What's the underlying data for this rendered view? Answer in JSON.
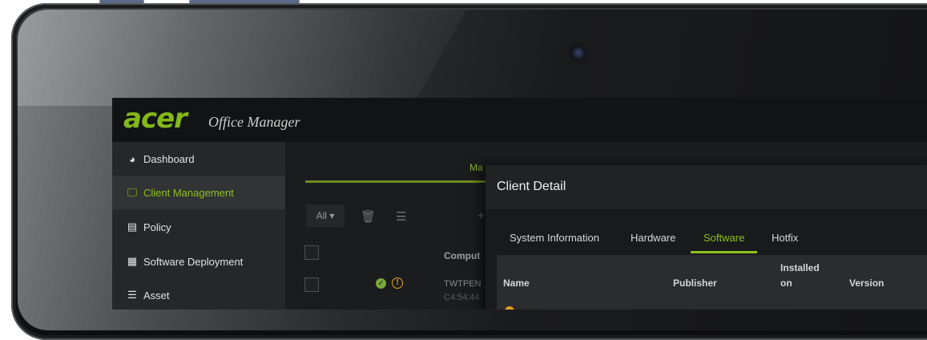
{
  "app": {
    "brand": "acer",
    "product": "Office Manager"
  },
  "sidebar": {
    "items": [
      {
        "label": "Dashboard",
        "icon": "pie-chart-icon",
        "glyph": "◕"
      },
      {
        "label": "Client Management",
        "icon": "monitor-icon",
        "glyph": "🖵"
      },
      {
        "label": "Policy",
        "icon": "policy-document-icon",
        "glyph": "▤"
      },
      {
        "label": "Software Deployment",
        "icon": "grid-icon",
        "glyph": "▦"
      },
      {
        "label": "Asset",
        "icon": "list-icon",
        "glyph": "☰"
      }
    ],
    "active_index": 1
  },
  "main": {
    "tab_fragment": "Ma",
    "filter": "All ▾",
    "toolbar_fragment": "+",
    "column_fragment": "Comput",
    "row": {
      "name_fragment": "TWTPEN",
      "sub_fragment": "C4:54:44"
    }
  },
  "client_detail": {
    "title": "Client Detail",
    "tabs": [
      "System Information",
      "Hardware",
      "Software",
      "Hotfix"
    ],
    "active_tab": "Software",
    "columns": [
      "Name",
      "Publisher",
      "Installed on",
      "Version"
    ]
  },
  "colors": {
    "accent": "#8cc21d",
    "warning": "#e7a21d",
    "ok": "#7aa83a"
  }
}
